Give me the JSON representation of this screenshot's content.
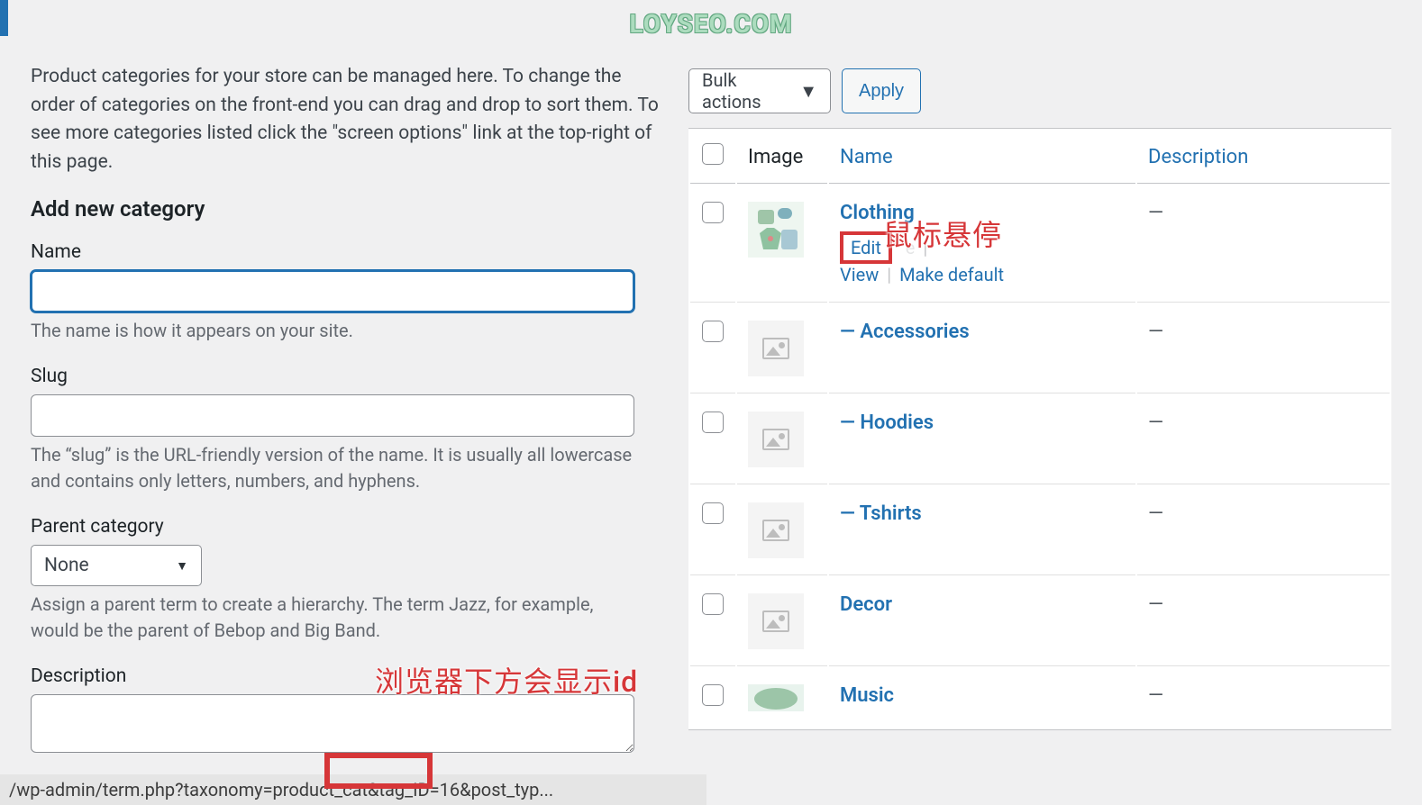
{
  "watermark": "LOYSEO.COM",
  "intro": "Product categories for your store can be managed here. To change the order of categories on the front-end you can drag and drop to sort them. To see more categories listed click the \"screen options\" link at the top-right of this page.",
  "form": {
    "heading": "Add new category",
    "name_label": "Name",
    "name_value": "",
    "name_help": "The name is how it appears on your site.",
    "slug_label": "Slug",
    "slug_value": "",
    "slug_help": "The “slug” is the URL-friendly version of the name. It is usually all lowercase and contains only letters, numbers, and hyphens.",
    "parent_label": "Parent category",
    "parent_value": "None",
    "parent_help": "Assign a parent term to create a hierarchy. The term Jazz, for example, would be the parent of Bebop and Big Band.",
    "description_label": "Description",
    "description_value": ""
  },
  "bulk": {
    "label": "Bulk actions",
    "apply": "Apply"
  },
  "table": {
    "columns": {
      "image": "Image",
      "name": "Name",
      "description": "Description"
    },
    "rows": [
      {
        "name": "Clothing",
        "indent": false,
        "thumb_type": "clothing",
        "desc": "—",
        "show_actions": true
      },
      {
        "name": "Accessories",
        "indent": true,
        "thumb_type": "placeholder",
        "desc": "—",
        "show_actions": false
      },
      {
        "name": "Hoodies",
        "indent": true,
        "thumb_type": "placeholder",
        "desc": "—",
        "show_actions": false
      },
      {
        "name": "Tshirts",
        "indent": true,
        "thumb_type": "placeholder",
        "desc": "—",
        "show_actions": false
      },
      {
        "name": "Decor",
        "indent": false,
        "thumb_type": "placeholder",
        "desc": "—",
        "show_actions": false
      },
      {
        "name": "Music",
        "indent": false,
        "thumb_type": "music",
        "desc": "—",
        "show_actions": false
      }
    ],
    "actions": {
      "edit": "Edit",
      "quick_partial": "e",
      "sep": "|",
      "view": "View",
      "make_default": "Make default"
    },
    "indent_prefix": "— "
  },
  "annotations": {
    "hover": "鼠标悬停",
    "browser_id": "浏览器下方会显示id"
  },
  "status_bar": "/wp-admin/term.php?taxonomy=product_cat&tag_ID=16&post_typ..."
}
